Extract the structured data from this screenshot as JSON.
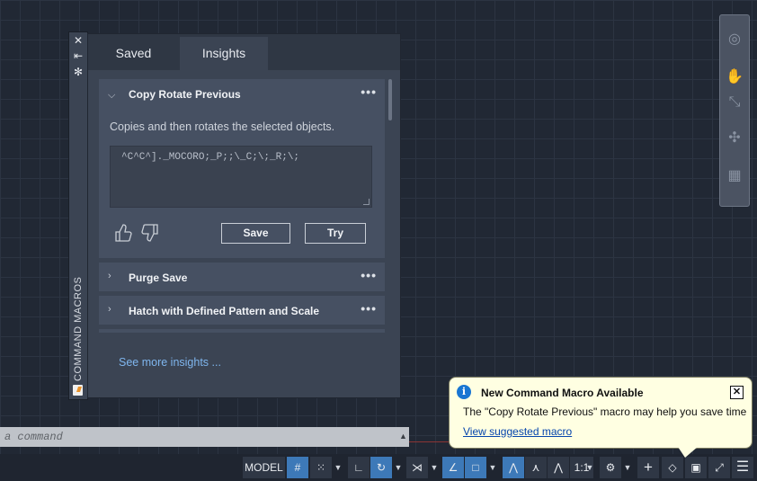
{
  "palette": {
    "side_title": "COMMAND MACROS",
    "tabs": [
      {
        "label": "Saved"
      },
      {
        "label": "Insights"
      }
    ],
    "active_tab": "Insights",
    "macros": [
      {
        "title": "Copy Rotate Previous",
        "expanded": true,
        "description": "Copies and then rotates the selected objects.",
        "macro_text": "^C^C^]._MOCORO;_P;;\\_C;\\;_R;\\;",
        "save_label": "Save",
        "try_label": "Try"
      },
      {
        "title": "Purge Save",
        "expanded": false
      },
      {
        "title": "Hatch with Defined Pattern and Scale",
        "expanded": false
      }
    ],
    "more_icon": "ellipsis",
    "see_more_label": "See more insights ..."
  },
  "command_line": {
    "placeholder": "a command"
  },
  "status_bar": {
    "model_label": "MODEL",
    "scale_label": "1:1"
  },
  "notification": {
    "title": "New Command Macro Available",
    "body": "The \"Copy Rotate Previous\" macro may help you save time",
    "link": "View suggested macro",
    "close": "✕"
  },
  "colors": {
    "canvas": "#212834",
    "palette_bg": "#3b4453",
    "card_bg": "#465062",
    "link": "#7fb6ee",
    "status_active": "#3d79b8",
    "notification_bg": "#ffffe2"
  }
}
